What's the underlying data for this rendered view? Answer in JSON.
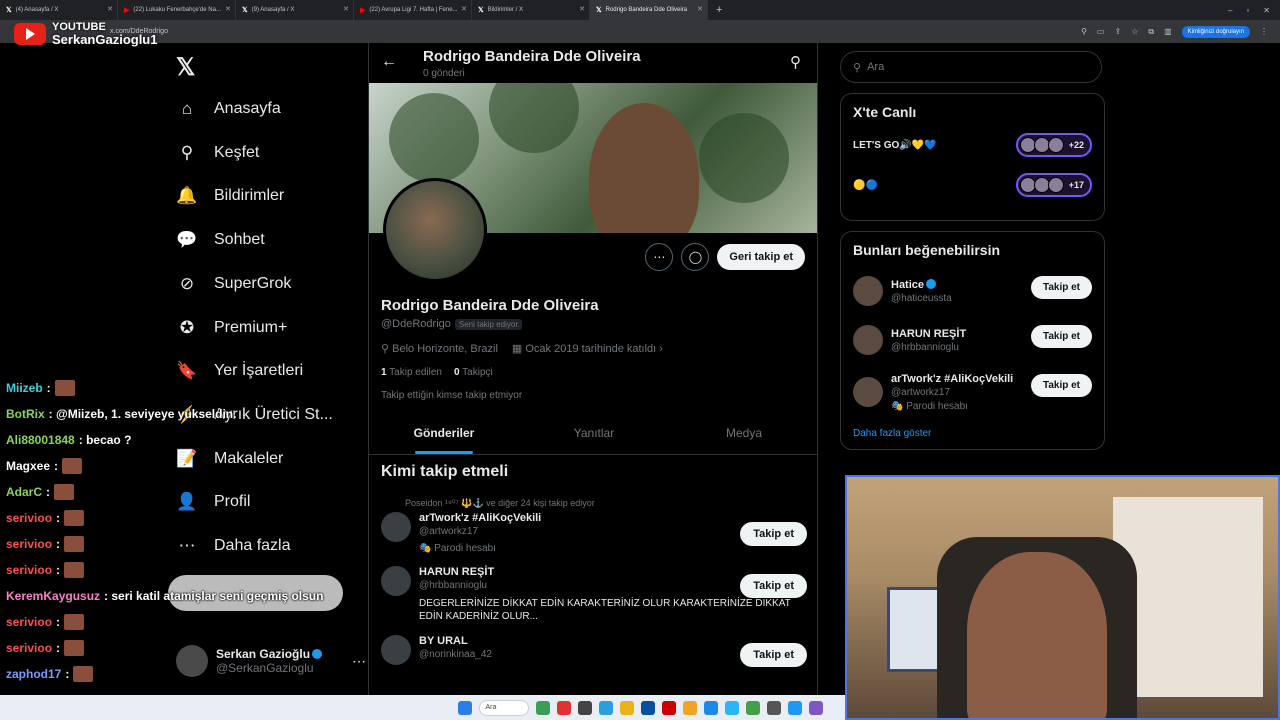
{
  "browser": {
    "tabs": [
      {
        "favicon": "x-icon",
        "title": "(4) Anasayfa / X",
        "active": false
      },
      {
        "favicon": "youtube-icon",
        "title": "(22) Lukaku Fenerbahçe'de Na...",
        "active": false
      },
      {
        "favicon": "x-icon",
        "title": "(9) Anasayfa / X",
        "active": false
      },
      {
        "favicon": "youtube-icon",
        "title": "(22) Avrupa Ligi 7. Hafta | Fene...",
        "active": false
      },
      {
        "favicon": "x-icon",
        "title": "Bildirimler / X",
        "active": false
      },
      {
        "favicon": "x-icon",
        "title": "Rodrigo Bandeira Dde Oliveira",
        "active": true
      }
    ],
    "url": "x.com/DdeRodrigo",
    "verify_chip": "Kimliğinizi doğrulayın"
  },
  "stream_overlay": {
    "platform": "YOUTUBE",
    "channel": "SerkanGazioglu1"
  },
  "nav": {
    "logo": "𝕏",
    "items": [
      {
        "icon": "home-icon",
        "glyph": "⌂",
        "label": "Anasayfa"
      },
      {
        "icon": "search-icon",
        "glyph": "⚲",
        "label": "Keşfet"
      },
      {
        "icon": "bell-icon",
        "glyph": "🔔",
        "label": "Bildirimler"
      },
      {
        "icon": "chat-icon",
        "glyph": "💬",
        "label": "Sohbet"
      },
      {
        "icon": "grok-icon",
        "glyph": "⊘",
        "label": "SuperGrok"
      },
      {
        "icon": "premium-icon",
        "glyph": "✪",
        "label": "Premium+"
      },
      {
        "icon": "bookmark-icon",
        "glyph": "🔖",
        "label": "Yer İşaretleri"
      },
      {
        "icon": "creator-icon",
        "glyph": "⚡",
        "label": "Ayrık Üretici St..."
      },
      {
        "icon": "articles-icon",
        "glyph": "📝",
        "label": "Makaleler"
      },
      {
        "icon": "profile-icon",
        "glyph": "👤",
        "label": "Profil"
      },
      {
        "icon": "more-icon",
        "glyph": "⋯",
        "label": "Daha fazla"
      }
    ],
    "account": {
      "name": "Serkan Gazioğlu",
      "handle": "@SerkanGazioglu"
    }
  },
  "profile": {
    "header_name": "Rodrigo Bandeira Dde Oliveira",
    "post_count": "0 gönderi",
    "display_name": "Rodrigo Bandeira Dde Oliveira",
    "handle": "@DdeRodrigo",
    "follows_you_badge": "Seni takip ediyor",
    "location": "Belo Horizonte, Brazil",
    "joined": "Ocak 2019 tarihinde katıldı",
    "following_count": "1",
    "following_label": "Takip edilen",
    "followers_count": "0",
    "followers_label": "Takipçi",
    "no_followers_note": "Takip ettiğin kimse takip etmiyor",
    "follow_back_label": "Geri takip et",
    "tabs": [
      "Gönderiler",
      "Yanıtlar",
      "Medya"
    ]
  },
  "who_to_follow": {
    "title": "Kimi takip etmeli",
    "items": [
      {
        "social": "Poseidon ¹⁹⁰⁷ 🔱⚓ ve diğer 24 kişi takip ediyor",
        "name": "arTwork'z #AliKoçVekili",
        "handle": "@artworkz17",
        "sub": "🎭 Parodi hesabı",
        "bio": "",
        "button": "Takip et"
      },
      {
        "social": "",
        "name": "HARUN REŞİT",
        "handle": "@hrbbannioglu",
        "sub": "",
        "bio": "DEGERLERİNİZE DİKKAT EDİN KARAKTERİNİZ OLUR KARAKTERİNİZE DİKKAT EDİN KADERİNİZ OLUR...",
        "button": "Takip et"
      },
      {
        "social": "",
        "name": "BY URAL",
        "handle": "@norinkinaa_42",
        "sub": "",
        "bio": "",
        "button": "Takip et"
      }
    ]
  },
  "right": {
    "search_placeholder": "Ara",
    "live_title": "X'te Canlı",
    "live_rows": [
      {
        "text": "LET'S GO🔊💛💙",
        "count": "+22"
      },
      {
        "text": "🟡🔵",
        "count": "+17"
      }
    ],
    "suggest_title": "Bunları beğenebilirsin",
    "suggestions": [
      {
        "name": "Hatice",
        "verified": true,
        "handle": "@haticeussta",
        "sub": "",
        "button": "Takip et"
      },
      {
        "name": "HARUN REŞİT",
        "verified": false,
        "handle": "@hrbbannioglu",
        "sub": "",
        "button": "Takip et"
      },
      {
        "name": "arTwork'z #AliKoçVekili",
        "verified": false,
        "handle": "@artworkz17",
        "sub": "🎭 Parodi hesabı",
        "button": "Takip et"
      }
    ],
    "show_more": "Daha fazla göster"
  },
  "chat": [
    {
      "user": "Miizeb",
      "color": "#3fd0e0",
      "msg": ":"
    },
    {
      "user": "BotRix",
      "color": "#8bd35a",
      "msg": ": @Miizeb, 1. seviyeye yükseldin."
    },
    {
      "user": "Ali88001848",
      "color": "#8bd35a",
      "msg": ": becao ?"
    },
    {
      "user": "Magxee",
      "color": "#ffffff",
      "msg": ":"
    },
    {
      "user": "AdarC",
      "color": "#8bd35a",
      "msg": ":"
    },
    {
      "user": "serivioo",
      "color": "#ff4c4c",
      "msg": ":"
    },
    {
      "user": "serivioo",
      "color": "#ff4c4c",
      "msg": ":"
    },
    {
      "user": "serivioo",
      "color": "#ff4c4c",
      "msg": ":"
    },
    {
      "user": "KeremKaygusuz",
      "color": "#ff7fc8",
      "msg": ": seri katil atamişlar seni geçmiş olsun"
    },
    {
      "user": "serivioo",
      "color": "#ff4c4c",
      "msg": ":"
    },
    {
      "user": "serivioo",
      "color": "#ff4c4c",
      "msg": ":"
    },
    {
      "user": "zaphod17",
      "color": "#7b9cff",
      "msg": ":"
    }
  ],
  "taskbar": {
    "search_label": "Ara"
  }
}
